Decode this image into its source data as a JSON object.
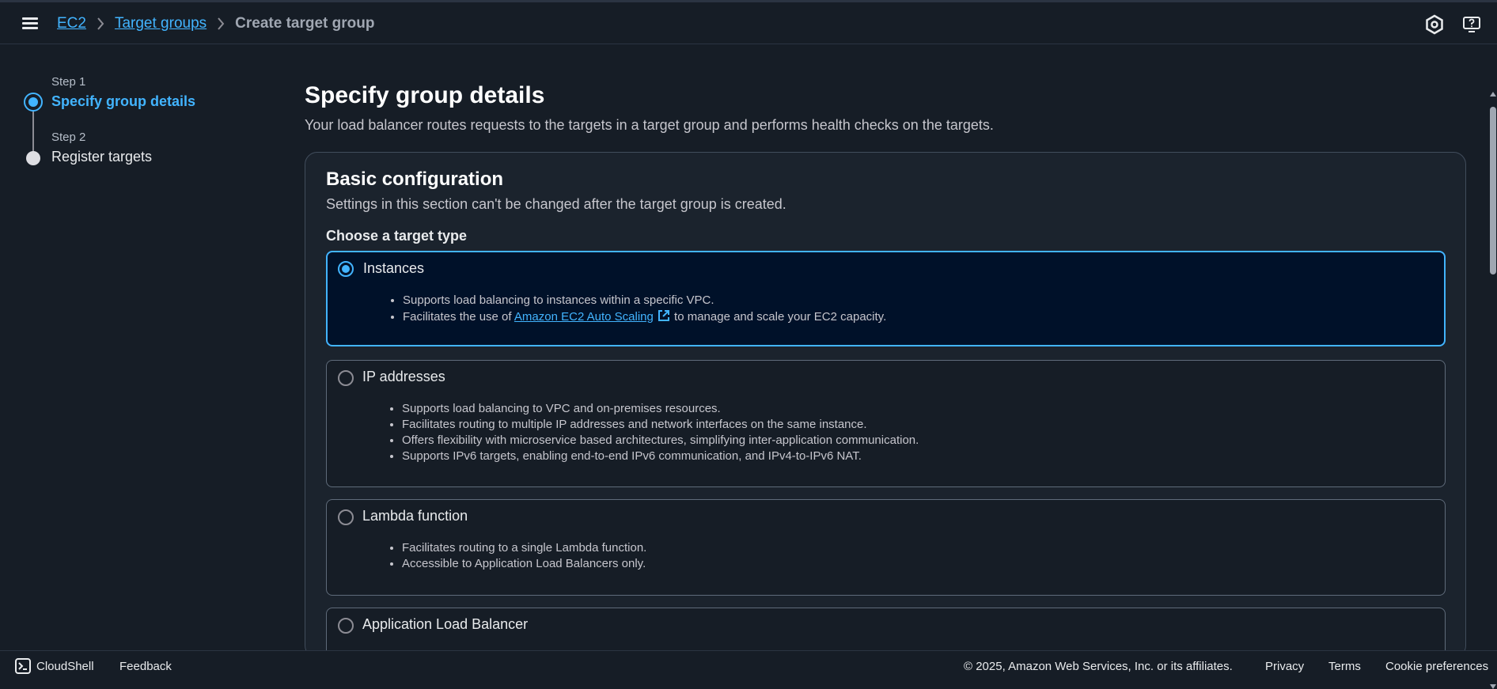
{
  "header": {
    "breadcrumbs": [
      "EC2",
      "Target groups"
    ],
    "current": "Create target group"
  },
  "steps": [
    {
      "step_label": "Step 1",
      "title": "Specify group details",
      "state": "active"
    },
    {
      "step_label": "Step 2",
      "title": "Register targets",
      "state": "inactive"
    }
  ],
  "page": {
    "title": "Specify group details",
    "description": "Your load balancer routes requests to the targets in a target group and performs health checks on the targets."
  },
  "basic_config": {
    "title": "Basic configuration",
    "description": "Settings in this section can't be changed after the target group is created.",
    "target_type_label": "Choose a target type",
    "options": [
      {
        "title": "Instances",
        "selected": true,
        "bullets": [
          "Supports load balancing to instances within a specific VPC.",
          {
            "prefix": "Facilitates the use of ",
            "link": "Amazon EC2 Auto Scaling",
            "suffix": " to manage and scale your EC2 capacity."
          }
        ]
      },
      {
        "title": "IP addresses",
        "selected": false,
        "bullets": [
          "Supports load balancing to VPC and on-premises resources.",
          "Facilitates routing to multiple IP addresses and network interfaces on the same instance.",
          "Offers flexibility with microservice based architectures, simplifying inter-application communication.",
          "Supports IPv6 targets, enabling end-to-end IPv6 communication, and IPv4-to-IPv6 NAT."
        ]
      },
      {
        "title": "Lambda function",
        "selected": false,
        "bullets": [
          "Facilitates routing to a single Lambda function.",
          "Accessible to Application Load Balancers only."
        ]
      },
      {
        "title": "Application Load Balancer",
        "selected": false,
        "bullets": []
      }
    ]
  },
  "footer": {
    "cloudshell": "CloudShell",
    "feedback": "Feedback",
    "copyright": "© 2025, Amazon Web Services, Inc. or its affiliates.",
    "privacy": "Privacy",
    "terms": "Terms",
    "cookies": "Cookie preferences"
  },
  "colors": {
    "accent": "#42b4ff",
    "background": "#161d26",
    "selected_tile": "#001129"
  }
}
